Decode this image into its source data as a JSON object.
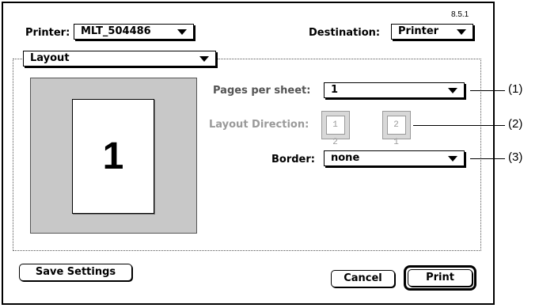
{
  "dialog": {
    "version": "8.5.1",
    "printer_label": "Printer:",
    "printer_value": "MLT_504486",
    "destination_label": "Destination:",
    "destination_value": "Printer"
  },
  "layout_panel": {
    "panel_select": "Layout",
    "preview_number": "1",
    "pages_per_sheet_label": "Pages per sheet:",
    "pages_per_sheet_value": "1",
    "layout_direction_label": "Layout Direction:",
    "direction_ltr": "1 2",
    "direction_rtl": "2 1",
    "border_label": "Border:",
    "border_value": "none"
  },
  "buttons": {
    "save_settings": "Save Settings",
    "cancel": "Cancel",
    "print": "Print"
  },
  "callouts": [
    "(1)",
    "(2)",
    "(3)"
  ]
}
